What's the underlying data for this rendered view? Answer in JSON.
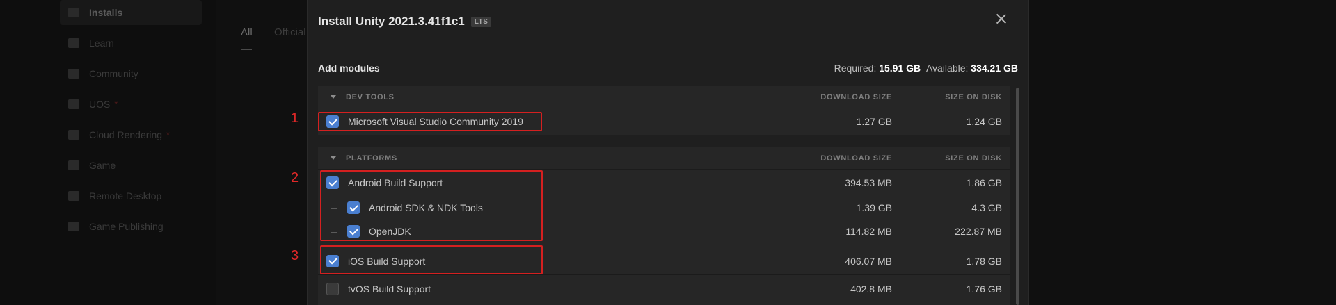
{
  "background": {
    "sidebar": [
      {
        "label": "Installs",
        "icon": "lock-icon",
        "active": true
      },
      {
        "label": "Learn",
        "icon": "graduation-cap-icon"
      },
      {
        "label": "Community",
        "icon": "people-icon"
      },
      {
        "label": "UOS",
        "icon": "grid-icon",
        "dot": "*"
      },
      {
        "label": "Cloud Rendering",
        "icon": "cloud-icon",
        "dot": "*"
      },
      {
        "label": "Game",
        "icon": "gamepad-icon"
      },
      {
        "label": "Remote Desktop",
        "icon": "monitor-icon"
      },
      {
        "label": "Game Publishing",
        "icon": "publish-icon"
      }
    ],
    "tabs": [
      "All",
      "Official"
    ]
  },
  "dialog": {
    "title": "Install Unity 2021.3.41f1c1",
    "badge": "LTS",
    "add_modules": "Add modules",
    "required_label": "Required:",
    "required_value": "15.91 GB",
    "available_label": "Available:",
    "available_value": "334.21 GB",
    "sections": [
      {
        "title": "DEV TOOLS",
        "col_download": "DOWNLOAD SIZE",
        "col_disk": "SIZE ON DISK",
        "rows": [
          {
            "label": "Microsoft Visual Studio Community 2019",
            "download": "1.27 GB",
            "disk": "1.24 GB",
            "checked": true
          }
        ]
      },
      {
        "title": "PLATFORMS",
        "col_download": "DOWNLOAD SIZE",
        "col_disk": "SIZE ON DISK",
        "rows": [
          {
            "label": "Android Build Support",
            "download": "394.53 MB",
            "disk": "1.86 GB",
            "checked": true
          },
          {
            "label": "Android SDK & NDK Tools",
            "download": "1.39 GB",
            "disk": "4.3 GB",
            "checked": true,
            "child": true
          },
          {
            "label": "OpenJDK",
            "download": "114.82 MB",
            "disk": "222.87 MB",
            "checked": true,
            "child": true
          },
          {
            "label": "iOS Build Support",
            "download": "406.07 MB",
            "disk": "1.78 GB",
            "checked": true
          },
          {
            "label": "tvOS Build Support",
            "download": "402.8 MB",
            "disk": "1.76 GB",
            "checked": false
          }
        ]
      }
    ]
  },
  "annotations": [
    "1",
    "2",
    "3"
  ],
  "colors": {
    "accent": "#4a7fd0",
    "highlight": "#d42020"
  }
}
